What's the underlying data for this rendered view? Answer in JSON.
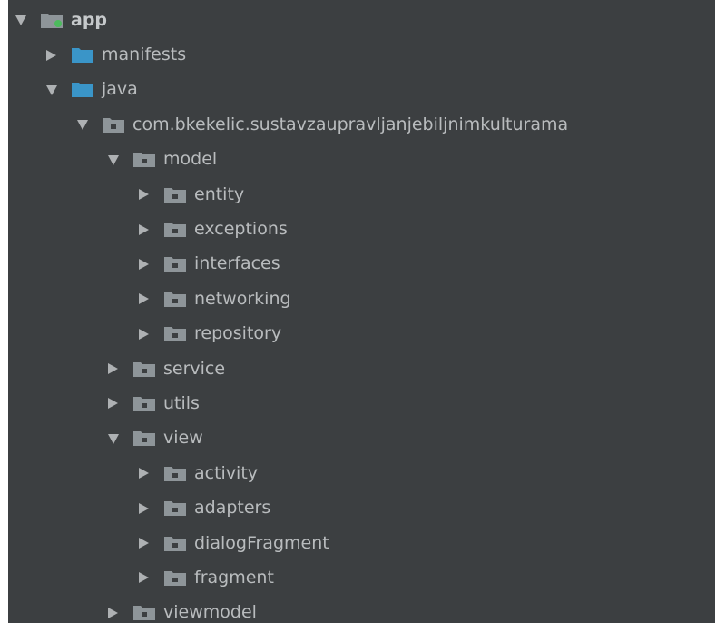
{
  "tree": [
    {
      "label": "app",
      "depth": 0,
      "expanded": true,
      "icon": "module-folder-icon",
      "bold": true
    },
    {
      "label": "manifests",
      "depth": 1,
      "expanded": false,
      "icon": "source-folder-icon"
    },
    {
      "label": "java",
      "depth": 1,
      "expanded": true,
      "icon": "source-folder-icon"
    },
    {
      "label": "com.bkekelic.sustavzaupravljanjebiljnimkulturama",
      "depth": 2,
      "expanded": true,
      "icon": "package-icon"
    },
    {
      "label": "model",
      "depth": 3,
      "expanded": true,
      "icon": "package-icon"
    },
    {
      "label": "entity",
      "depth": 4,
      "expanded": false,
      "icon": "package-icon"
    },
    {
      "label": "exceptions",
      "depth": 4,
      "expanded": false,
      "icon": "package-icon"
    },
    {
      "label": "interfaces",
      "depth": 4,
      "expanded": false,
      "icon": "package-icon"
    },
    {
      "label": "networking",
      "depth": 4,
      "expanded": false,
      "icon": "package-icon"
    },
    {
      "label": "repository",
      "depth": 4,
      "expanded": false,
      "icon": "package-icon"
    },
    {
      "label": "service",
      "depth": 3,
      "expanded": false,
      "icon": "package-icon"
    },
    {
      "label": "utils",
      "depth": 3,
      "expanded": false,
      "icon": "package-icon"
    },
    {
      "label": "view",
      "depth": 3,
      "expanded": true,
      "icon": "package-icon"
    },
    {
      "label": "activity",
      "depth": 4,
      "expanded": false,
      "icon": "package-icon"
    },
    {
      "label": "adapters",
      "depth": 4,
      "expanded": false,
      "icon": "package-icon"
    },
    {
      "label": "dialogFragment",
      "depth": 4,
      "expanded": false,
      "icon": "package-icon"
    },
    {
      "label": "fragment",
      "depth": 4,
      "expanded": false,
      "icon": "package-icon"
    },
    {
      "label": "viewmodel",
      "depth": 3,
      "expanded": false,
      "icon": "package-icon"
    }
  ],
  "colors": {
    "background": "#3c3f41",
    "text": "#b9bcbe",
    "arrow": "#aeb1b3",
    "module_folder": "#8e9599",
    "module_badge": "#4cbb5d",
    "source_folder": "#3a95c8",
    "package_folder": "#8e9599",
    "package_dot": "#3c3f41"
  }
}
